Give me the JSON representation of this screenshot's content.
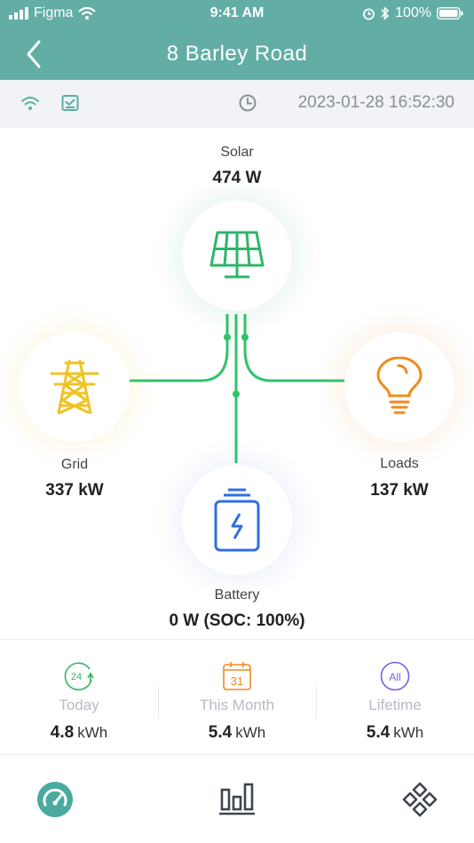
{
  "status_bar": {
    "carrier": "Figma",
    "time": "9:41 AM",
    "battery": "100%"
  },
  "header": {
    "title": "8 Barley Road"
  },
  "info_bar": {
    "timestamp": "2023-01-28 16:52:30"
  },
  "nodes": {
    "solar": {
      "label": "Solar",
      "value": "474 W"
    },
    "grid": {
      "label": "Grid",
      "value": "337 kW"
    },
    "loads": {
      "label": "Loads",
      "value": "137 kW"
    },
    "battery": {
      "label": "Battery",
      "value": "0 W (SOC: 100%)"
    }
  },
  "stats": [
    {
      "icon_text": "24",
      "name": "Today",
      "value": "4.8",
      "unit": "kWh"
    },
    {
      "icon_text": "31",
      "name": "This Month",
      "value": "5.4",
      "unit": "kWh"
    },
    {
      "icon_text": "All",
      "name": "Lifetime",
      "value": "5.4",
      "unit": "kWh"
    }
  ],
  "colors": {
    "header": "#62aea5",
    "flow_line": "#2fc46b",
    "solar": "#2fb56a",
    "grid": "#f0c324",
    "loads": "#f08a1e",
    "battery": "#2f6fe0",
    "today": "#35b566",
    "month": "#f08a1e",
    "lifetime": "#7a5de8"
  },
  "tabs": [
    {
      "icon": "gauge-icon",
      "active": true
    },
    {
      "icon": "bar-chart-icon",
      "active": false
    },
    {
      "icon": "devices-grid-icon",
      "active": false
    }
  ]
}
